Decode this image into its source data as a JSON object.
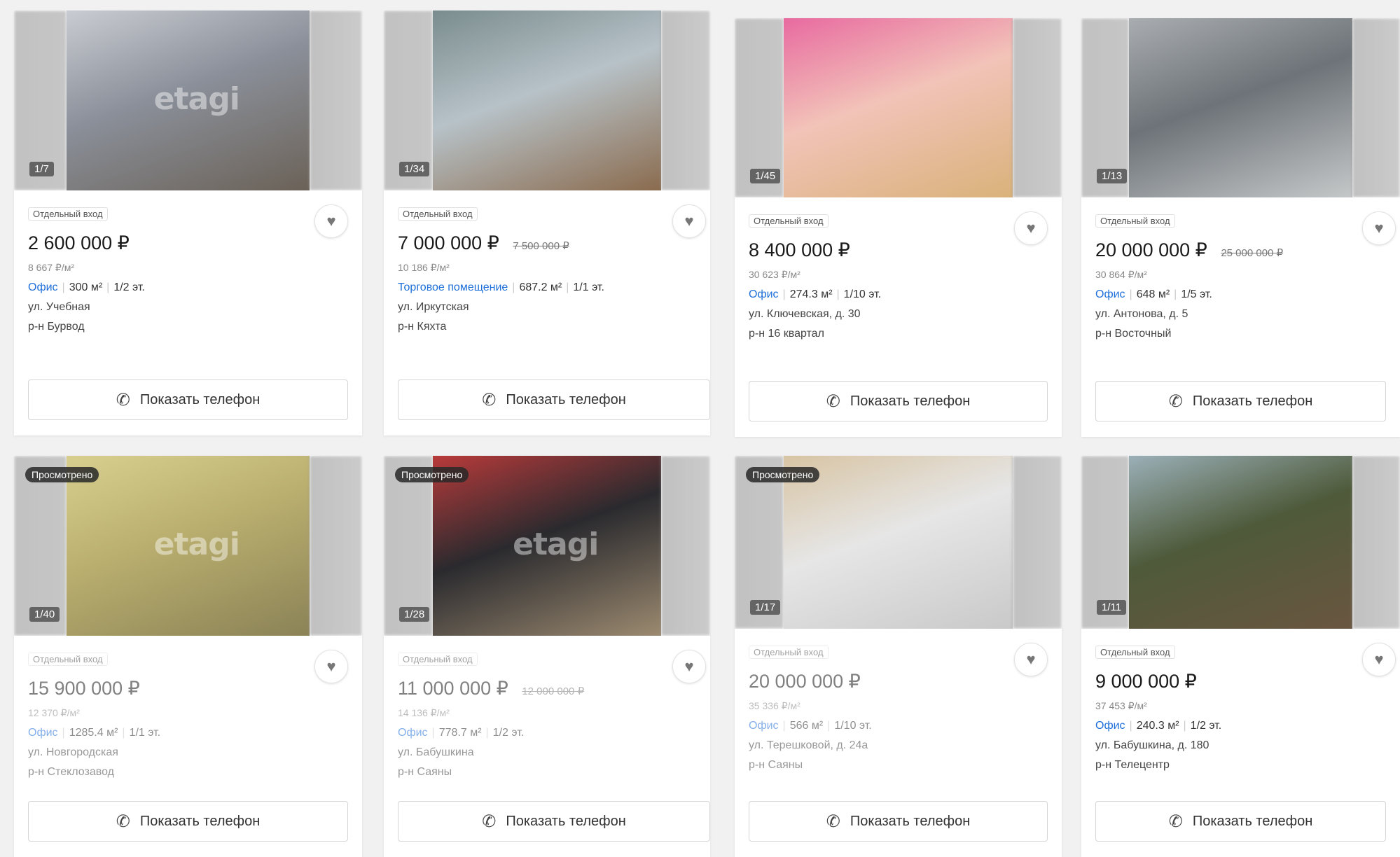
{
  "cards": [
    {
      "counter": "1/7",
      "viewed": "",
      "tag": "Отдельный вход",
      "price": "2 600 000 ₽",
      "old_price": "",
      "ppm": "8 667 ₽/м²",
      "type": "Офис",
      "area": "300 м²",
      "floor": "1/2 эт.",
      "address": "ул. Учебная",
      "district": "р-н Бурвод",
      "phone_label": "Показать телефон",
      "watermark": "etagi",
      "photo_colors": [
        "#8a8f99",
        "#c9ccd2",
        "#6b6258"
      ]
    },
    {
      "counter": "1/34",
      "viewed": "",
      "tag": "Отдельный вход",
      "price": "7 000 000 ₽",
      "old_price": "7 500 000 ₽",
      "ppm": "10 186 ₽/м²",
      "type": "Торговое помещение",
      "area": "687.2 м²",
      "floor": "1/1 эт.",
      "address": "ул. Иркутская",
      "district": "р-н Кяхта",
      "phone_label": "Показать телефон",
      "watermark": "",
      "photo_colors": [
        "#b7c2c8",
        "#7a8c8e",
        "#8a6b4e"
      ]
    },
    {
      "counter": "1/45",
      "viewed": "",
      "tag": "Отдельный вход",
      "price": "8 400 000 ₽",
      "old_price": "",
      "ppm": "30 623 ₽/м²",
      "type": "Офис",
      "area": "274.3 м²",
      "floor": "1/10 эт.",
      "address": "ул. Ключевская, д. 30",
      "district": "р-н 16 квартал",
      "phone_label": "Показать телефон",
      "watermark": "",
      "photo_colors": [
        "#f2c3b8",
        "#e86aa0",
        "#d9b27a"
      ]
    },
    {
      "counter": "1/13",
      "viewed": "",
      "tag": "Отдельный вход",
      "price": "20 000 000 ₽",
      "old_price": "25 000 000 ₽",
      "ppm": "30 864 ₽/м²",
      "type": "Офис",
      "area": "648 м²",
      "floor": "1/5 эт.",
      "address": "ул. Антонова, д. 5",
      "district": "р-н Восточный",
      "phone_label": "Показать телефон",
      "watermark": "",
      "photo_colors": [
        "#6d7378",
        "#a9adb0",
        "#c5c8c9"
      ]
    },
    {
      "counter": "1/40",
      "viewed": "Просмотрено",
      "tag": "Отдельный вход",
      "price": "15 900 000 ₽",
      "old_price": "",
      "ppm": "12 370 ₽/м²",
      "type": "Офис",
      "area": "1285.4 м²",
      "floor": "1/1 эт.",
      "address": "ул. Новгородская",
      "district": "р-н Стеклозавод",
      "phone_label": "Показать телефон",
      "watermark": "etagi",
      "photo_colors": [
        "#b9ae6e",
        "#d8cf8f",
        "#8b8257"
      ]
    },
    {
      "counter": "1/28",
      "viewed": "Просмотрено",
      "tag": "Отдельный вход",
      "price": "11 000 000 ₽",
      "old_price": "12 000 000 ₽",
      "ppm": "14 136 ₽/м²",
      "type": "Офис",
      "area": "778.7 м²",
      "floor": "1/2 эт.",
      "address": "ул. Бабушкина",
      "district": "р-н Саяны",
      "phone_label": "Показать телефон",
      "watermark": "etagi",
      "photo_colors": [
        "#2a2a2e",
        "#b93a3a",
        "#9c8a70"
      ]
    },
    {
      "counter": "1/17",
      "viewed": "Просмотрено",
      "tag": "Отдельный вход",
      "price": "20 000 000 ₽",
      "old_price": "",
      "ppm": "35 336 ₽/м²",
      "type": "Офис",
      "area": "566 м²",
      "floor": "1/10 эт.",
      "address": "ул. Терешковой, д. 24а",
      "district": "р-н Саяны",
      "phone_label": "Показать телефон",
      "watermark": "",
      "photo_colors": [
        "#e6e6e6",
        "#d8c4a3",
        "#c9c9c9"
      ]
    },
    {
      "counter": "1/11",
      "viewed": "",
      "tag": "Отдельный вход",
      "price": "9 000 000 ₽",
      "old_price": "",
      "ppm": "37 453 ₽/м²",
      "type": "Офис",
      "area": "240.3 м²",
      "floor": "1/2 эт.",
      "address": "ул. Бабушкина, д. 180",
      "district": "р-н Телецентр",
      "phone_label": "Показать телефон",
      "watermark": "",
      "photo_colors": [
        "#4e5a3a",
        "#9bb0b8",
        "#6a5640"
      ]
    }
  ],
  "icons": {
    "favorite": "heart-icon",
    "phone": "phone-icon"
  },
  "colors": {
    "link_blue": "#1e6fd9",
    "background": "#f1f1f2"
  }
}
